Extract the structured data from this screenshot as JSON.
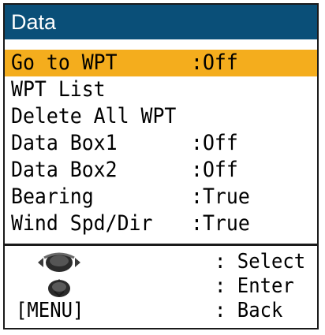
{
  "window": {
    "title": "Data"
  },
  "menu": {
    "items": [
      {
        "label": "Go to WPT",
        "value": ":Off",
        "selected": true
      },
      {
        "label": "WPT List",
        "value": ""
      },
      {
        "label": "Delete All WPT",
        "value": ""
      },
      {
        "label": "Data Box1",
        "value": ":Off"
      },
      {
        "label": "Data Box2",
        "value": ":Off"
      },
      {
        "label": "Bearing",
        "value": ":True"
      },
      {
        "label": "Wind Spd/Dir",
        "value": ":True"
      }
    ]
  },
  "legend": {
    "select": {
      "icon": "rotary-knob-icon",
      "text": ": Select"
    },
    "enter": {
      "icon": "knob-push-icon",
      "text": ": Enter"
    },
    "back": {
      "key": "[MENU]",
      "text": ": Back"
    }
  },
  "colors": {
    "title_bar": "#0a4f78",
    "highlight": "#f4ad1d",
    "text": "#000000"
  }
}
